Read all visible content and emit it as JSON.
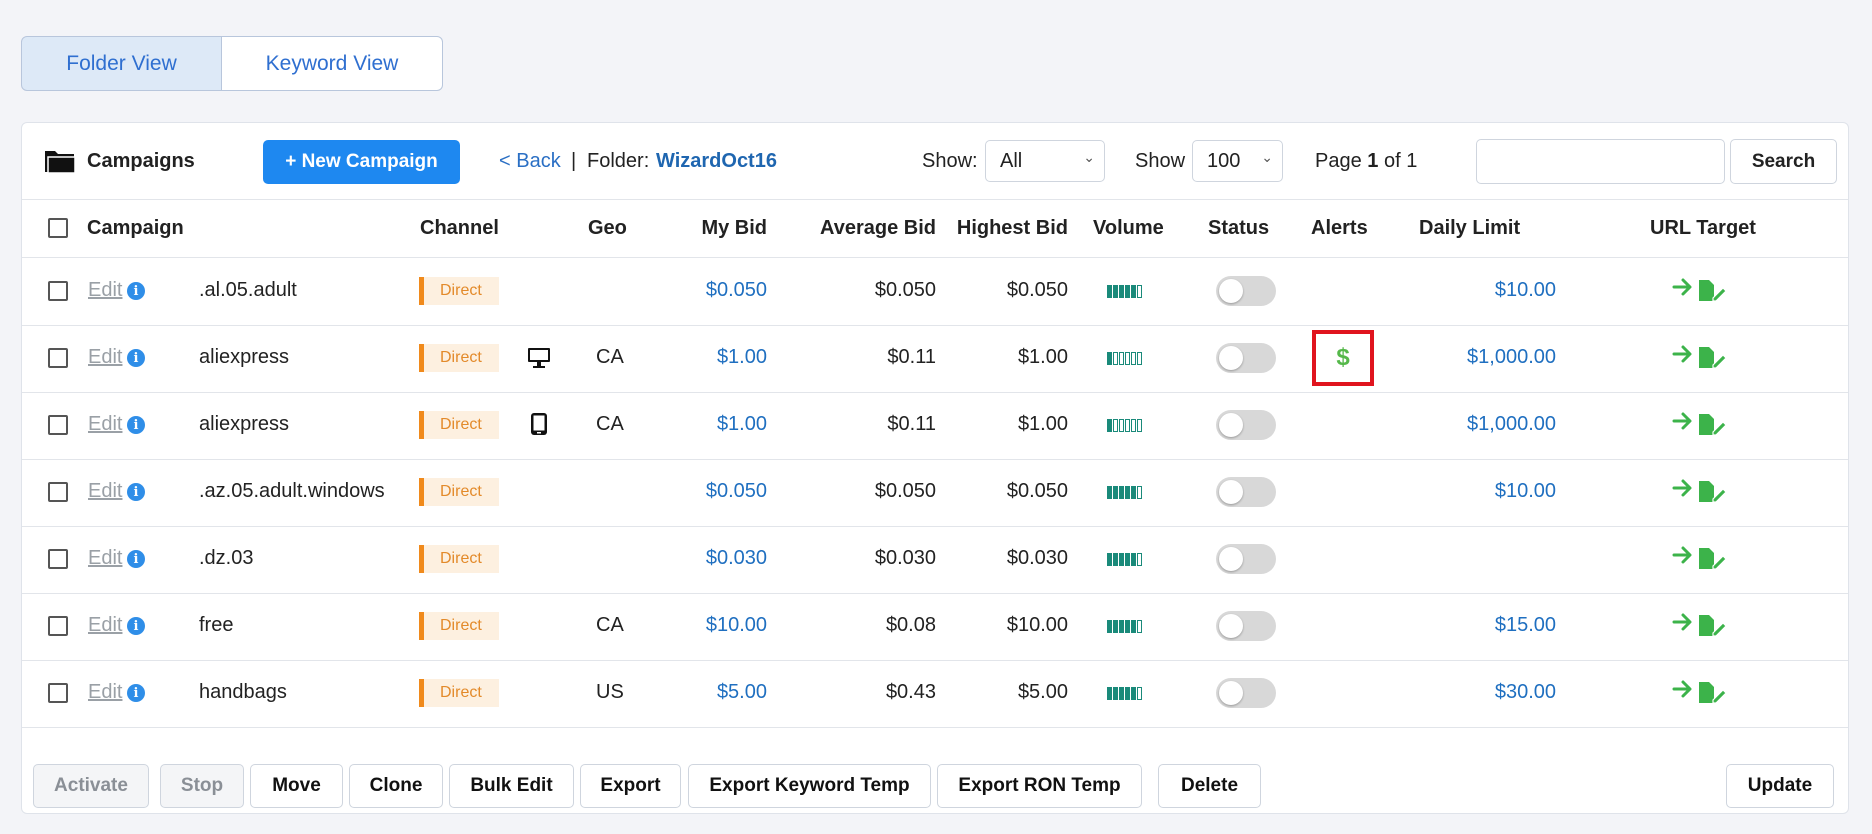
{
  "view_toggle": {
    "folder_view": "Folder View",
    "keyword_view": "Keyword View"
  },
  "toolbar": {
    "title": "Campaigns",
    "new_campaign": "+ New Campaign",
    "back": "< Back",
    "separator": "|",
    "folder_label": "Folder:",
    "folder_name": "WizardOct16",
    "show_label": "Show:",
    "show_value": "All",
    "show2_label": "Show",
    "perpage_value": "100",
    "pager_prefix": "Page",
    "pager_current": "1",
    "pager_mid": "of 1",
    "search_button": "Search",
    "search_value": ""
  },
  "columns": {
    "campaign": "Campaign",
    "channel": "Channel",
    "geo": "Geo",
    "my_bid": "My Bid",
    "avg_bid": "Average Bid",
    "high_bid": "Highest Bid",
    "volume": "Volume",
    "status": "Status",
    "alerts": "Alerts",
    "daily_limit": "Daily Limit",
    "url_target": "URL Target"
  },
  "edit_label": "Edit",
  "info_glyph": "i",
  "rows": [
    {
      "name": ".al.05.adult",
      "channel": "Direct",
      "device": "",
      "geo": "",
      "my_bid": "$0.050",
      "avg_bid": "$0.050",
      "high_bid": "$0.050",
      "volume": 5,
      "status": "off",
      "alert": "",
      "daily_limit": "$10.00"
    },
    {
      "name": "aliexpress",
      "channel": "Direct",
      "device": "desktop",
      "geo": "CA",
      "my_bid": "$1.00",
      "avg_bid": "$0.11",
      "high_bid": "$1.00",
      "volume": 1,
      "status": "off",
      "alert": "$",
      "daily_limit": "$1,000.00"
    },
    {
      "name": "aliexpress",
      "channel": "Direct",
      "device": "mobile",
      "geo": "CA",
      "my_bid": "$1.00",
      "avg_bid": "$0.11",
      "high_bid": "$1.00",
      "volume": 1,
      "status": "off",
      "alert": "",
      "daily_limit": "$1,000.00"
    },
    {
      "name": ".az.05.adult.windows",
      "channel": "Direct",
      "device": "",
      "geo": "",
      "my_bid": "$0.050",
      "avg_bid": "$0.050",
      "high_bid": "$0.050",
      "volume": 5,
      "status": "off",
      "alert": "",
      "daily_limit": "$10.00"
    },
    {
      "name": ".dz.03",
      "channel": "Direct",
      "device": "",
      "geo": "",
      "my_bid": "$0.030",
      "avg_bid": "$0.030",
      "high_bid": "$0.030",
      "volume": 5,
      "status": "off",
      "alert": "",
      "daily_limit": ""
    },
    {
      "name": "free",
      "channel": "Direct",
      "device": "",
      "geo": "CA",
      "my_bid": "$10.00",
      "avg_bid": "$0.08",
      "high_bid": "$10.00",
      "volume": 5,
      "status": "off",
      "alert": "",
      "daily_limit": "$15.00"
    },
    {
      "name": "handbags",
      "channel": "Direct",
      "device": "",
      "geo": "US",
      "my_bid": "$5.00",
      "avg_bid": "$0.43",
      "high_bid": "$5.00",
      "volume": 5,
      "status": "off",
      "alert": "",
      "daily_limit": "$30.00"
    }
  ],
  "footer": {
    "activate": "Activate",
    "stop": "Stop",
    "move": "Move",
    "clone": "Clone",
    "bulk_edit": "Bulk Edit",
    "export": "Export",
    "export_keyword_temp": "Export Keyword Temp",
    "export_ron_temp": "Export RON Temp",
    "delete": "Delete",
    "update": "Update"
  },
  "colors": {
    "accent": "#1e88f0",
    "link": "#1f6fc0",
    "channel": "#f08a1c",
    "alert_border": "#e0141e",
    "url_green": "#3cb34a"
  }
}
